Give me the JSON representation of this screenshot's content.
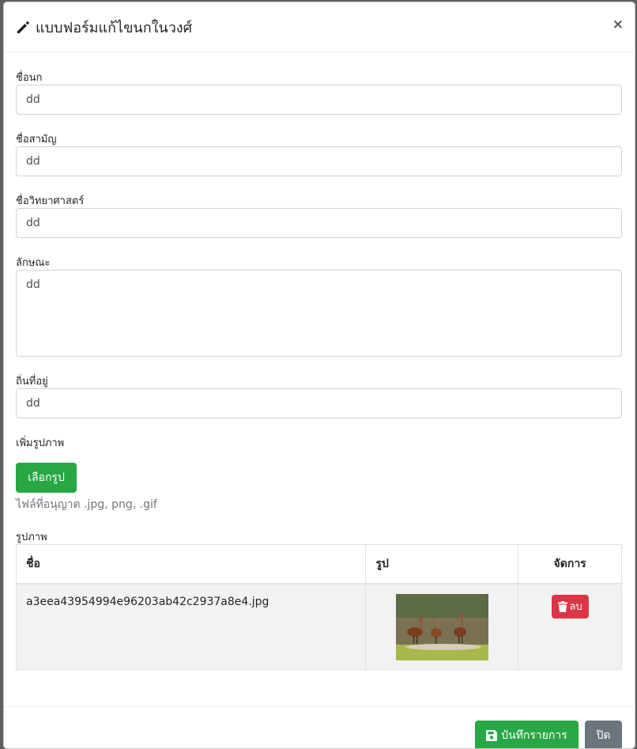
{
  "modal": {
    "title": "แบบฟอร์มแก้ไขนกในวงศ์",
    "close_symbol": "×",
    "accent_color": "#28a745",
    "danger_color": "#dc3545"
  },
  "form": {
    "bird_name": {
      "label": "ชื่อนก",
      "value": "dd"
    },
    "common_name": {
      "label": "ชื่อสามัญ",
      "value": "dd"
    },
    "scientific_name": {
      "label": "ชื่อวิทยาศาสตร์",
      "value": "dd"
    },
    "characteristics": {
      "label": "ลักษณะ",
      "value": "dd"
    },
    "habitat": {
      "label": "ถิ่นที่อยู่",
      "value": "dd"
    },
    "add_image": {
      "label": "เพิ่มรูปภาพ",
      "button_label": "เลือกรูป",
      "hint": "ไฟล์ที่อนุญาต .jpg, png, .gif"
    }
  },
  "images_table": {
    "section_label": "รูปภาพ",
    "headers": [
      "ชื่อ",
      "รูป",
      "จัดการ"
    ],
    "rows": [
      {
        "filename": "a3eea43954994e96203ab42c2937a8e4.jpg",
        "delete_label": "ลบ"
      }
    ]
  },
  "footer": {
    "save_label": "บันทึกรายการ",
    "close_label": "ปิด"
  }
}
